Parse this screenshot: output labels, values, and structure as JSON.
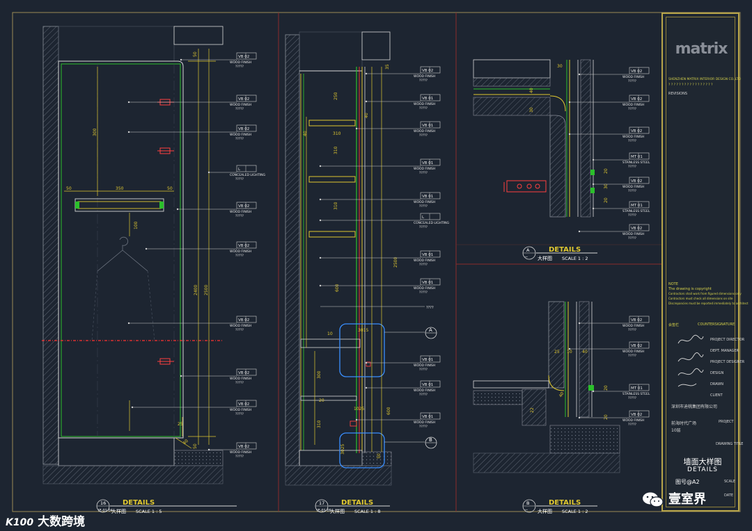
{
  "tags": {
    "wood": {
      "code": "VB 02",
      "line1": "WOOD FINISH",
      "line2": "?????"
    },
    "wood01": {
      "code": "VB 01",
      "line1": "WOOD FINISH",
      "line2": "?????"
    },
    "light": {
      "code": "L",
      "line1": "CONCEALED LIGHTING",
      "line2": "?????"
    },
    "steel": {
      "code": "MT 01",
      "line1": "STAINLESS STEEL",
      "line2": "?????"
    },
    "unknown": "????"
  },
  "dims": {
    "d50": "50",
    "d300": "300",
    "d350": "350",
    "d100": "100",
    "d2400": "2400",
    "d2500": "2500",
    "d25": "25",
    "d40": "40",
    "d250": "250",
    "d310": "310",
    "d35": "35",
    "d600": "600",
    "d10": "10",
    "d3015": "3015",
    "d3025": "3025",
    "d20": "20",
    "d1025": "1025",
    "d22": "22",
    "d30": "30"
  },
  "markers": {
    "a": "A",
    "b": "B"
  },
  "captions": [
    {
      "num": "16",
      "sheet": "IE-01-04",
      "title": "DETAILS",
      "cn": "大样图",
      "scale": "SCALE 1 : 5"
    },
    {
      "num": "17",
      "sheet": "IE-01-09",
      "title": "DETAILS",
      "cn": "大样图",
      "scale": "SCALE 1 : 8"
    },
    {
      "num": "A",
      "sheet": "一",
      "title": "DETAILS",
      "cn": "大样图",
      "scale": "SCALE 1 : 2"
    },
    {
      "num": "B",
      "sheet": "一",
      "title": "DETAILS",
      "cn": "大样图",
      "scale": "SCALE 1 : 2"
    }
  ],
  "title_block": {
    "logo": "matrix",
    "company": "SHENZHEN MATRIX INTERIOR DESIGN CO.,LTD",
    "company_sub": "? ? ? ? ? ? ? ? ? ? ? ? ? ? ? ? ?",
    "revision_label": "REVISIONS",
    "remarks_lines": [
      "NOTE",
      "The drawing is copyright",
      "Contractors shall work from figured dimensions only",
      "Contractors must check all dimensions on site",
      "Discrepancies must be reported immediately to architect"
    ],
    "approval": "会签栏",
    "countersign": "COUNTERSIGNATURE",
    "roles": [
      "PROJECT DIRECTOR",
      "DEPT. MANAGER",
      "PROJECT DESIGNER",
      "DESIGN",
      "DRAWN",
      "CLIENT"
    ],
    "client": "深圳市迪桃集团有限公司",
    "project_label": "PROJECT",
    "project_cn": "前海时代广场",
    "project_sub": "10层",
    "drawing_title_label": "DRAWING TITLE",
    "drawing_title_cn": "墙面大样图",
    "drawing_title_en": "DETAILS",
    "drawing_no": "图号@A2",
    "scale_label": "SCALE",
    "date_label": "DATE"
  },
  "watermarks": {
    "left": "大数跨境",
    "right": "壹室界",
    "left_logo": "K100"
  }
}
